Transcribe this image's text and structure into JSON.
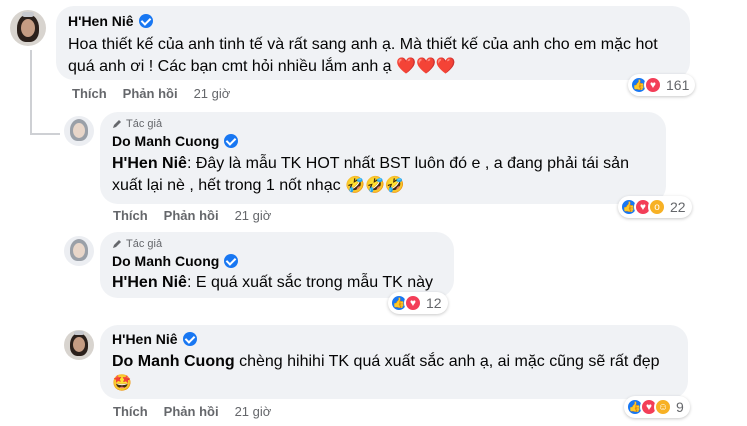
{
  "comments": [
    {
      "author": "H'Hen Niê",
      "text": "Hoa thiết kế của anh tinh tế và rất sang anh ạ. Mà thiết kế của anh cho em mặc hot quá anh ơi ! Các bạn cmt hỏi nhiều lắm anh ạ",
      "emoji": "❤️❤️❤️",
      "like_label": "Thích",
      "reply_label": "Phản hồi",
      "time": "21 giờ",
      "reaction_count": "161",
      "reactions": [
        "like-icon",
        "love-icon"
      ]
    },
    {
      "author_tag": "Tác giả",
      "author": "Do Manh Cuong",
      "mention": "H'Hen Niê",
      "text": ": Đây là mẫu TK HOT nhất BST luôn đó e , a đang phải tái sản xuất lại nè , hết trong 1 nốt nhạc",
      "emoji": "🤣🤣🤣",
      "like_label": "Thích",
      "reply_label": "Phản hồi",
      "time": "21 giờ",
      "reaction_count": "22",
      "reactions": [
        "like-icon",
        "love-icon",
        "wow-icon"
      ]
    },
    {
      "author_tag": "Tác giả",
      "author": "Do Manh Cuong",
      "mention": "H'Hen Niê",
      "text": ": E quá xuất sắc trong mẫu TK này",
      "like_label": "Thích",
      "reply_label": "Phản hồi",
      "time": "21 giờ",
      "reaction_count": "12",
      "reactions": [
        "like-icon",
        "love-icon"
      ]
    },
    {
      "author": "H'Hen Niê",
      "mention": "Do Manh Cuong",
      "text": "chèng hihihi TK quá xuất sắc anh ạ, ai mặc cũng sẽ rất đẹp",
      "emoji": "🤩",
      "like_label": "Thích",
      "reply_label": "Phản hồi",
      "time": "21 giờ",
      "reaction_count": "9",
      "reactions": [
        "like-icon",
        "love-icon",
        "care-icon"
      ]
    }
  ],
  "colors": {
    "bubble": "#f0f2f5",
    "verified": "#1877f2",
    "meta_text": "#65676b",
    "like": "#1877f2",
    "love": "#f33e58",
    "wow": "#f7b125"
  }
}
